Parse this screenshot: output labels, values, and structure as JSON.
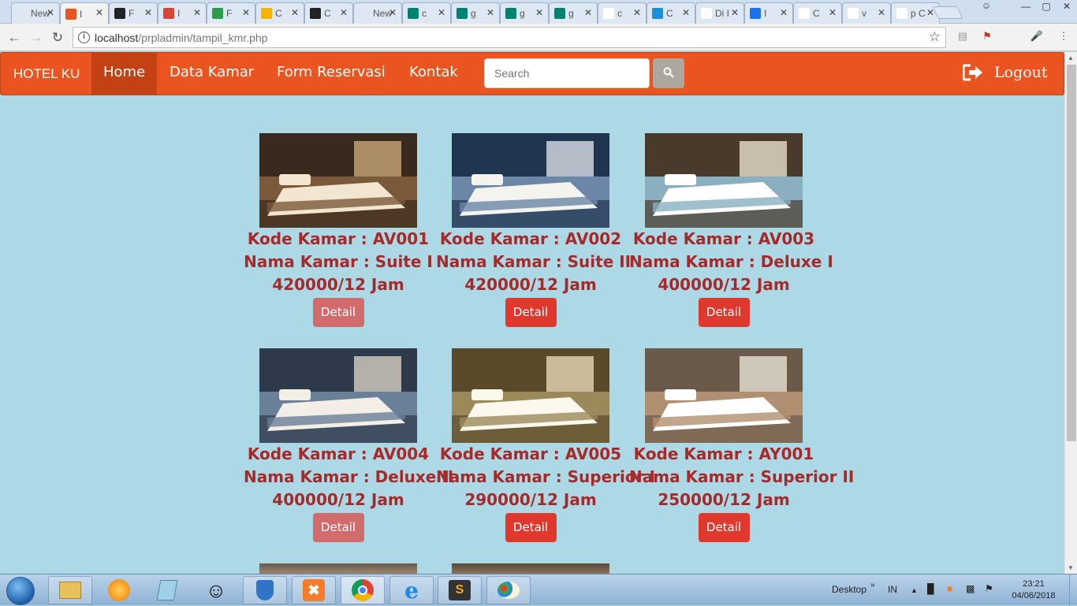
{
  "browser": {
    "tabs": [
      {
        "label": "New",
        "color": "#dfe8f2"
      },
      {
        "label": "I",
        "color": "#e95420"
      },
      {
        "label": "F",
        "color": "#222222"
      },
      {
        "label": "I",
        "color": "#d44638"
      },
      {
        "label": "F",
        "color": "#2a9d4b"
      },
      {
        "label": "C",
        "color": "#f4b400"
      },
      {
        "label": "C",
        "color": "#222222"
      },
      {
        "label": "New",
        "color": "#dfe8f2"
      },
      {
        "label": "c",
        "color": "#008272"
      },
      {
        "label": "g",
        "color": "#008272"
      },
      {
        "label": "g",
        "color": "#008272"
      },
      {
        "label": "g",
        "color": "#008272"
      },
      {
        "label": "c",
        "color": "#ffffff"
      },
      {
        "label": "C",
        "color": "#1d8fd6"
      },
      {
        "label": "Di I",
        "color": "#ffffff"
      },
      {
        "label": "I",
        "color": "#1a73e8"
      },
      {
        "label": "C",
        "color": "#ffffff"
      },
      {
        "label": "v",
        "color": "#ffffff"
      },
      {
        "label": "p C",
        "color": "#ffffff"
      }
    ],
    "url_host": "localhost",
    "url_path": "/prpladmin/tampil_kmr.php"
  },
  "navbar": {
    "brand": "HOTEL KU",
    "links": [
      "Home",
      "Data Kamar",
      "Form Reservasi",
      "Kontak"
    ],
    "search_placeholder": "Search",
    "logout": "Logout"
  },
  "rooms": [
    {
      "kode": "Kode Kamar : AV001",
      "nama": "Nama Kamar : Suite I",
      "harga": "420000/12 Jam",
      "detail": "Detail",
      "image_desc": "suite-bedroom-dark",
      "detail_style": "light"
    },
    {
      "kode": "Kode Kamar : AV002",
      "nama": "Nama Kamar : Suite II",
      "harga": "420000/12 Jam",
      "detail": "Detail",
      "image_desc": "suite-bedroom-sea",
      "detail_style": "dark"
    },
    {
      "kode": "Kode Kamar : AV003",
      "nama": "Nama Kamar : Deluxe I",
      "harga": "400000/12 Jam",
      "detail": "Detail",
      "image_desc": "deluxe-bedroom",
      "detail_style": "dark"
    },
    {
      "kode": "Kode Kamar : AV004",
      "nama": "Nama Kamar : Deluxe II",
      "harga": "400000/12 Jam",
      "detail": "Detail",
      "image_desc": "deluxe-bedroom-window",
      "detail_style": "light"
    },
    {
      "kode": "Kode Kamar : AV005",
      "nama": "Nama Kamar : Superior I",
      "harga": "290000/12 Jam",
      "detail": "Detail",
      "image_desc": "superior-bedroom",
      "detail_style": "dark"
    },
    {
      "kode": "Kode Kamar : AY001",
      "nama": "Nama Kamar : Superior II",
      "harga": "250000/12 Jam",
      "detail": "Detail",
      "image_desc": "superior-twin-room",
      "detail_style": "dark"
    }
  ],
  "taskbar": {
    "desktop_label": "Desktop",
    "lang": "IN",
    "time": "23:21",
    "date": "04/06/2018"
  },
  "colors": {
    "navbar": "#e95420",
    "active_nav": "#c34113",
    "page_bg": "#add8e6",
    "room_text": "#a52a2a",
    "detail_dark": "#df382c",
    "detail_light": "#d26b6b"
  }
}
